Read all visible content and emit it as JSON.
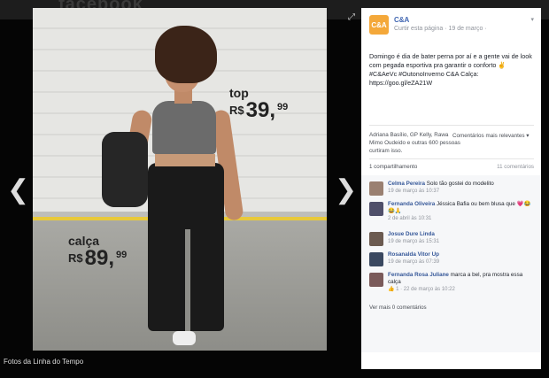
{
  "background_title": "facebook",
  "photo": {
    "price_top": {
      "label": "top",
      "currency": "R$",
      "amount": "39,",
      "cents": "99"
    },
    "price_bottom": {
      "label": "calça",
      "currency": "R$",
      "amount": "89,",
      "cents": "99"
    },
    "caption": "Fotos da Linha do Tempo"
  },
  "nav": {
    "prev": "❮",
    "next": "❯",
    "expand": "⤢"
  },
  "panel": {
    "logo": "C&A",
    "page_name": "C&A",
    "meta": "Curtir esta página · 19 de março · ",
    "post_text": "Domingo é dia de bater perna por aí e a gente vai de look com pegada esportiva pra garantir o conforto ✌ #C&AeVc #OutonoInverno C&A Calça: https://goo.gl/eZA21W",
    "likes": "Adriana Basílio, GP Kelly, Rawa Mimo Oudeido e outras 600 pessoas curtiram isso.",
    "reactions": "Comentários mais relevantes ▾",
    "share": "1 compartilhamento",
    "comment_count": "11 comentários",
    "comments": [
      {
        "name": "Celma Pereira",
        "text": " Solo tão gostei do modelito",
        "meta": "19 de março às 10:37"
      },
      {
        "name": "Fernanda Oliveira",
        "text": " Jéssica Bafia ou bem blusa que 💗😂😂🙏",
        "meta": "2 de abril às 10:31"
      },
      {
        "name": "Josue Dure Linda",
        "text": "",
        "meta": "19 de março às 15:31"
      },
      {
        "name": "Rosanalda Vitor Up",
        "text": "",
        "meta": "19 de março às 07:39"
      },
      {
        "name": "Fernanda Rosa Juliane",
        "text": " marca a bel, pra mostra essa calça",
        "meta": "👍 1 · 22 de março às 10:22"
      }
    ],
    "more_comments": "Ver mais 0 comentários"
  }
}
